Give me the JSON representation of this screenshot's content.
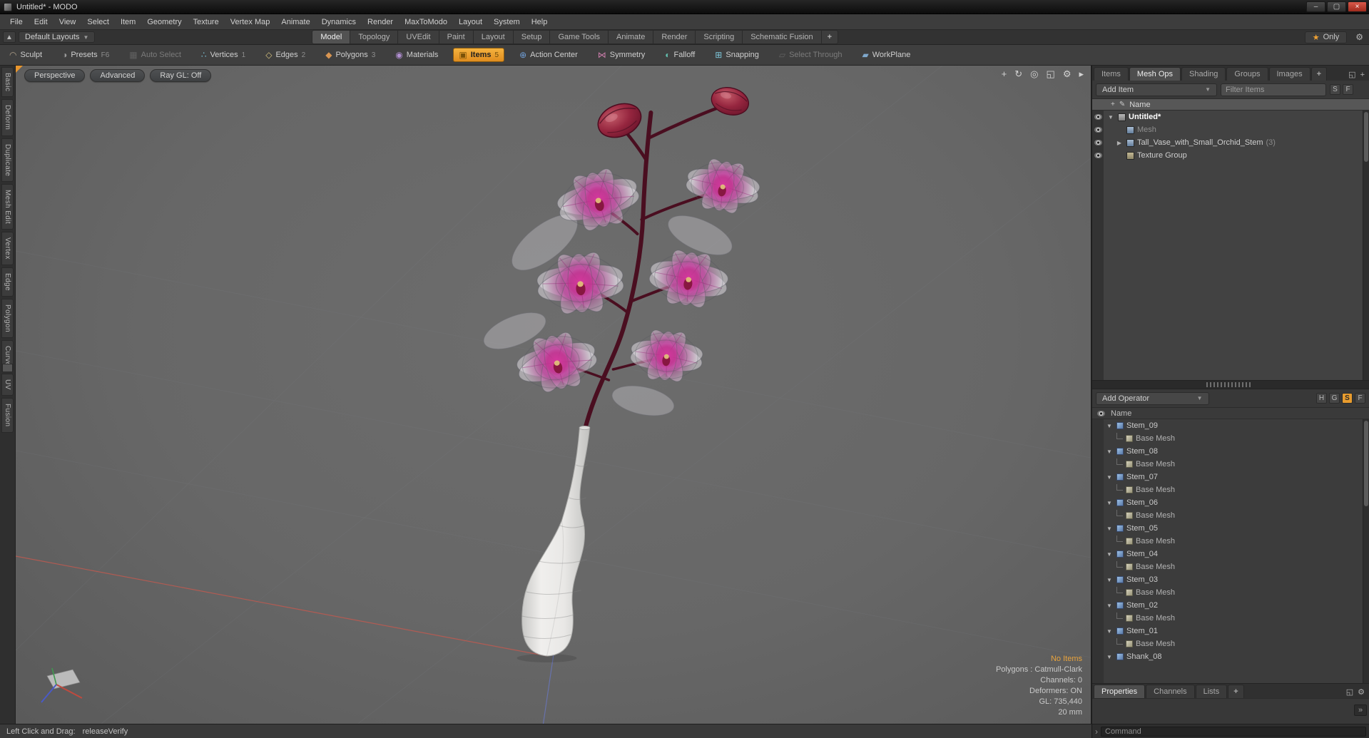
{
  "window": {
    "title": "Untitled* - MODO",
    "controls": [
      {
        "name": "minimize",
        "glyph": "–"
      },
      {
        "name": "maximize",
        "glyph": "▢"
      },
      {
        "name": "close",
        "glyph": "×"
      }
    ]
  },
  "menubar": [
    "File",
    "Edit",
    "View",
    "Select",
    "Item",
    "Geometry",
    "Texture",
    "Vertex Map",
    "Animate",
    "Dynamics",
    "Render",
    "MaxToModo",
    "Layout",
    "System",
    "Help"
  ],
  "layout_bar": {
    "layout_switcher": "Default Layouts",
    "tabs": [
      "Model",
      "Topology",
      "UVEdit",
      "Paint",
      "Layout",
      "Setup",
      "Game Tools",
      "Animate",
      "Render",
      "Scripting",
      "Schematic Fusion"
    ],
    "active_tab": "Model",
    "add_tab": "+",
    "only_toggle": "Only"
  },
  "toolbar": [
    {
      "label": "Sculpt",
      "key": "",
      "state": "normal",
      "icon": "sculpt"
    },
    {
      "label": "Presets",
      "key": "F6",
      "state": "normal",
      "icon": "presets"
    },
    {
      "label": "Auto Select",
      "key": "",
      "state": "disabled",
      "icon": "auto-select"
    },
    {
      "label": "Vertices",
      "key": "1",
      "state": "normal",
      "icon": "vertices"
    },
    {
      "label": "Edges",
      "key": "2",
      "state": "normal",
      "icon": "edges"
    },
    {
      "label": "Polygons",
      "key": "3",
      "state": "normal",
      "icon": "polygons"
    },
    {
      "label": "Materials",
      "key": "",
      "state": "normal",
      "icon": "materials"
    },
    {
      "label": "Items",
      "key": "5",
      "state": "active",
      "icon": "items"
    },
    {
      "label": "Action Center",
      "key": "",
      "state": "normal",
      "icon": "action-center"
    },
    {
      "label": "Symmetry",
      "key": "",
      "state": "normal",
      "icon": "symmetry"
    },
    {
      "label": "Falloff",
      "key": "",
      "state": "normal",
      "icon": "falloff"
    },
    {
      "label": "Snapping",
      "key": "",
      "state": "normal",
      "icon": "snapping"
    },
    {
      "label": "Select Through",
      "key": "",
      "state": "disabled",
      "icon": "select-through"
    },
    {
      "label": "WorkPlane",
      "key": "",
      "state": "normal",
      "icon": "workplane"
    }
  ],
  "left_tabs": [
    "Basic",
    "Deform",
    "Duplicate",
    "Mesh Edit",
    "Vertex",
    "Edge",
    "Polygon",
    "Curve",
    "UV",
    "Fusion"
  ],
  "viewport": {
    "buttons": [
      "Perspective",
      "Advanced",
      "Ray GL: Off"
    ],
    "nav_icons": [
      "pan-icon",
      "rotate-icon",
      "zoom-icon",
      "maximize-icon",
      "settings-icon",
      "next-icon"
    ],
    "status": {
      "selection": "No Items",
      "lines": [
        "Polygons : Catmull-Clark",
        "Channels: 0",
        "Deformers: ON",
        "GL: 735,440",
        "20 mm"
      ]
    }
  },
  "item_list": {
    "tabs": [
      "Items",
      "Mesh Ops",
      "Shading",
      "Groups",
      "Images"
    ],
    "active_tab": "Mesh Ops",
    "add_tab": "+",
    "add_button": "Add Item",
    "filter_placeholder": "Filter Items",
    "mini_buttons": [
      "S",
      "F"
    ],
    "header": "Name",
    "rows": [
      {
        "label": "Untitled*",
        "style": "bold",
        "icon": "scene",
        "expander": "▼",
        "indent": 0
      },
      {
        "label": "Mesh",
        "style": "dim",
        "icon": "mesh",
        "expander": "",
        "indent": 1
      },
      {
        "label": "Tall_Vase_with_Small_Orchid_Stem",
        "suffix": "(3)",
        "style": "normal",
        "icon": "mesh",
        "expander": "▶",
        "indent": 1
      },
      {
        "label": "Texture Group",
        "style": "normal",
        "icon": "group",
        "expander": "",
        "indent": 1
      }
    ]
  },
  "mesh_ops": {
    "add_button": "Add Operator",
    "mini_buttons": [
      "H",
      "G",
      "S",
      "F"
    ],
    "active_mini": "S",
    "header": "Name",
    "rows": [
      {
        "name": "Stem_09",
        "children": [
          "Base Mesh"
        ]
      },
      {
        "name": "Stem_08",
        "children": [
          "Base Mesh"
        ]
      },
      {
        "name": "Stem_07",
        "children": [
          "Base Mesh"
        ]
      },
      {
        "name": "Stem_06",
        "children": [
          "Base Mesh"
        ]
      },
      {
        "name": "Stem_05",
        "children": [
          "Base Mesh"
        ]
      },
      {
        "name": "Stem_04",
        "children": [
          "Base Mesh"
        ]
      },
      {
        "name": "Stem_03",
        "children": [
          "Base Mesh"
        ]
      },
      {
        "name": "Stem_02",
        "children": [
          "Base Mesh"
        ]
      },
      {
        "name": "Stem_01",
        "children": [
          "Base Mesh"
        ]
      },
      {
        "name": "Shank_08",
        "children": []
      }
    ]
  },
  "bottom_panel": {
    "tabs": [
      "Properties",
      "Channels",
      "Lists"
    ],
    "active_tab": "Properties",
    "add_tab": "+"
  },
  "command_bar": {
    "placeholder": "Command"
  },
  "status_bar": {
    "label": "Left Click and Drag:",
    "value": "releaseVerify"
  },
  "colors": {
    "accent_orange": "#e89c2e",
    "status_orange": "#e8a33d",
    "viewport_background": "#666666",
    "stem_maroon": "#4a0e20",
    "petal_magenta": "#c74aa4",
    "vase_white": "#ededed"
  }
}
